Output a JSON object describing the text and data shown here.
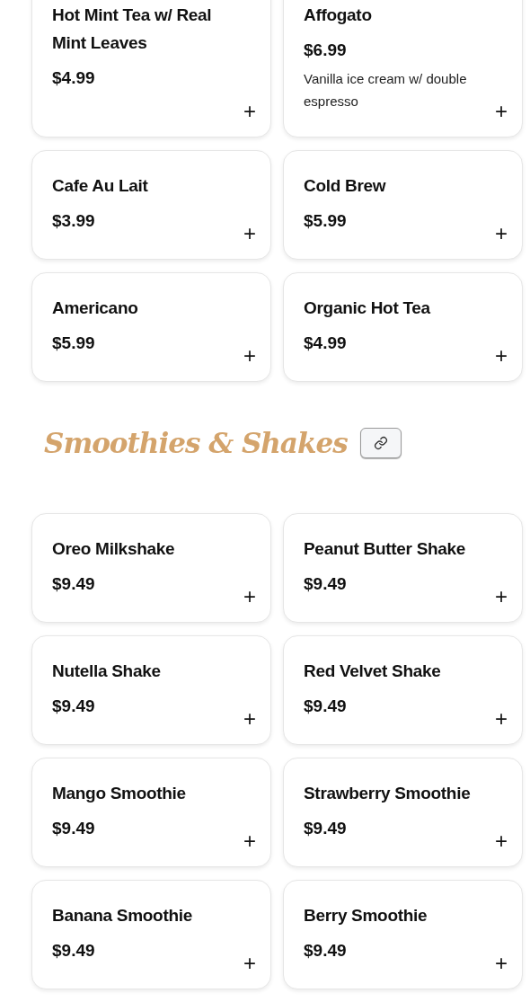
{
  "sections": [
    {
      "items": [
        {
          "name": "Hot Mint Tea w/ Real Mint Leaves",
          "price": "$4.99",
          "add": "+"
        },
        {
          "name": "Affogato",
          "price": "$6.99",
          "description": "Vanilla ice cream w/ double espresso",
          "add": "+"
        },
        {
          "name": "Cafe Au Lait",
          "price": "$3.99",
          "add": "+"
        },
        {
          "name": "Cold Brew",
          "price": "$5.99",
          "add": "+"
        },
        {
          "name": "Americano",
          "price": "$5.99",
          "add": "+"
        },
        {
          "name": "Organic Hot Tea",
          "price": "$4.99",
          "add": "+"
        }
      ]
    },
    {
      "title": "Smoothies & Shakes",
      "items": [
        {
          "name": "Oreo Milkshake",
          "price": "$9.49",
          "add": "+"
        },
        {
          "name": "Peanut Butter Shake",
          "price": "$9.49",
          "add": "+"
        },
        {
          "name": "Nutella Shake",
          "price": "$9.49",
          "add": "+"
        },
        {
          "name": "Red Velvet Shake",
          "price": "$9.49",
          "add": "+"
        },
        {
          "name": "Mango Smoothie",
          "price": "$9.49",
          "add": "+"
        },
        {
          "name": "Strawberry Smoothie",
          "price": "$9.49",
          "add": "+"
        },
        {
          "name": "Banana Smoothie",
          "price": "$9.49",
          "add": "+"
        },
        {
          "name": "Berry Smoothie",
          "price": "$9.49",
          "add": "+"
        }
      ]
    }
  ]
}
